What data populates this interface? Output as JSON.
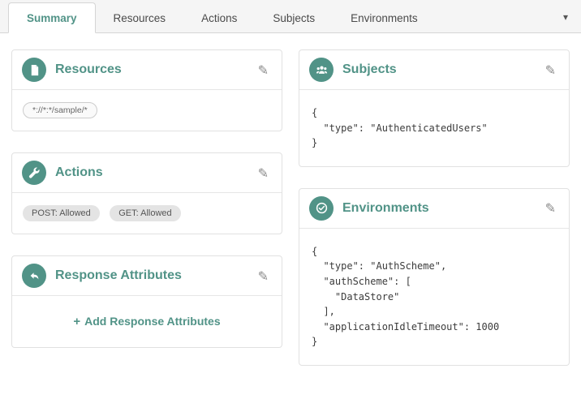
{
  "tabs": [
    {
      "label": "Summary",
      "active": true
    },
    {
      "label": "Resources",
      "active": false
    },
    {
      "label": "Actions",
      "active": false
    },
    {
      "label": "Subjects",
      "active": false
    },
    {
      "label": "Environments",
      "active": false
    }
  ],
  "icons": {
    "edit": "✎",
    "caret": "▾",
    "plus": "+"
  },
  "colors": {
    "accent": "#519387",
    "pill_bg": "#e4e4e4",
    "border": "#e1e1e1"
  },
  "cards": {
    "resources": {
      "title": "Resources",
      "resource_value": "*://*:*/sample/*"
    },
    "actions": {
      "title": "Actions",
      "pills": [
        "POST: Allowed",
        "GET: Allowed"
      ]
    },
    "response_attributes": {
      "title": "Response Attributes",
      "add_label": "Add Response Attributes"
    },
    "subjects": {
      "title": "Subjects",
      "json": "{\n  \"type\": \"AuthenticatedUsers\"\n}"
    },
    "environments": {
      "title": "Environments",
      "json": "{\n  \"type\": \"AuthScheme\",\n  \"authScheme\": [\n    \"DataStore\"\n  ],\n  \"applicationIdleTimeout\": 1000\n}"
    }
  }
}
